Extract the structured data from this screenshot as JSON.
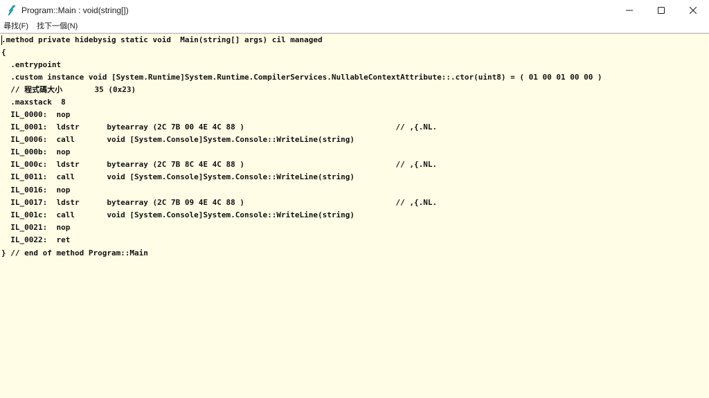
{
  "window": {
    "title": "Program::Main : void(string[])"
  },
  "menu": {
    "items": [
      "尋找(F)",
      "找下一個(N)"
    ]
  },
  "code": {
    "lines": [
      ".method private hidebysig static void  Main(string[] args) cil managed",
      "{",
      "  .entrypoint",
      "  .custom instance void [System.Runtime]System.Runtime.CompilerServices.NullableContextAttribute::.ctor(uint8) = ( 01 00 01 00 00 )",
      "  // 程式碼大小       35 (0x23)",
      "  .maxstack  8",
      "  IL_0000:  nop",
      "  IL_0001:  ldstr      bytearray (2C 7B 00 4E 4C 88 )                                 // ,{.NL.",
      "  IL_0006:  call       void [System.Console]System.Console::WriteLine(string)",
      "  IL_000b:  nop",
      "  IL_000c:  ldstr      bytearray (2C 7B 8C 4E 4C 88 )                                 // ,{.NL.",
      "  IL_0011:  call       void [System.Console]System.Console::WriteLine(string)",
      "  IL_0016:  nop",
      "  IL_0017:  ldstr      bytearray (2C 7B 09 4E 4C 88 )                                 // ,{.NL.",
      "  IL_001c:  call       void [System.Console]System.Console::WriteLine(string)",
      "  IL_0021:  nop",
      "  IL_0022:  ret",
      "} // end of method Program::Main"
    ]
  },
  "colors": {
    "background": "#fffde6",
    "text": "#111111",
    "icon_accent": "#1ab0c8"
  }
}
